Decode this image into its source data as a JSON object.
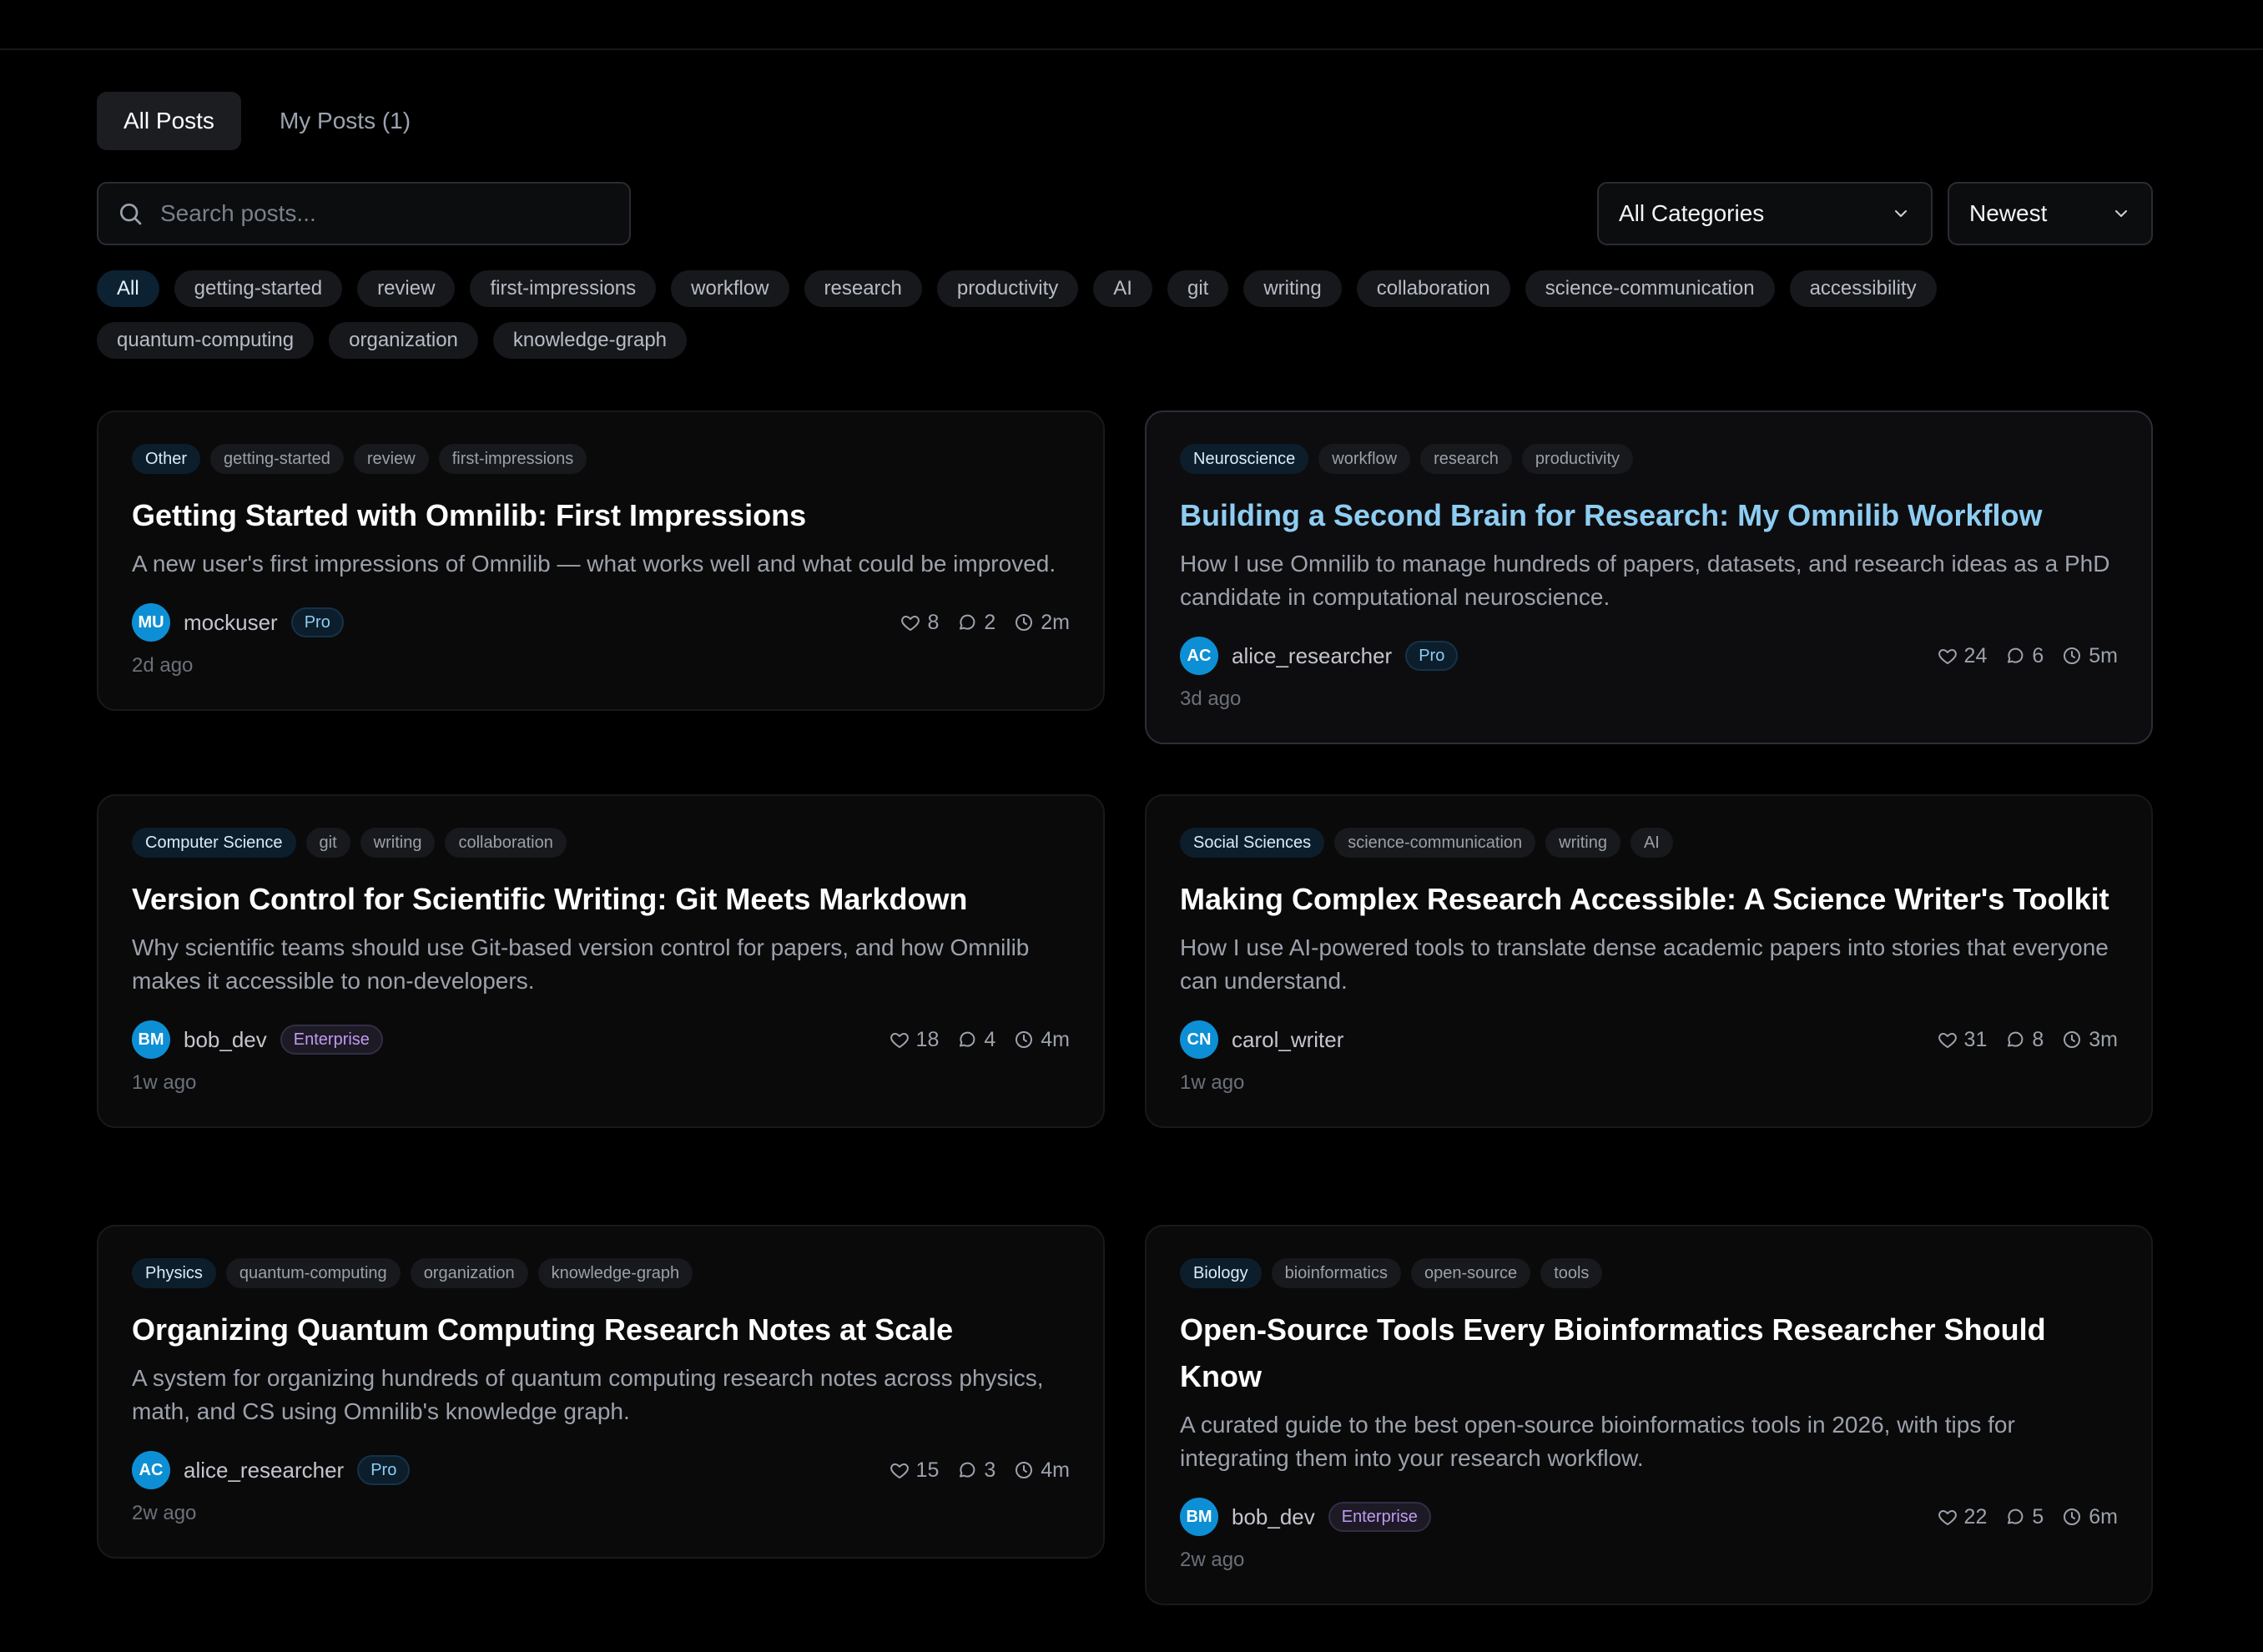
{
  "tabs": [
    {
      "label": "All Posts",
      "active": true
    },
    {
      "label": "My Posts (1)",
      "active": false
    }
  ],
  "search": {
    "placeholder": "Search posts...",
    "value": ""
  },
  "filters": {
    "category": "All Categories",
    "sort": "Newest"
  },
  "tag_chips": [
    "All",
    "getting-started",
    "review",
    "first-impressions",
    "workflow",
    "research",
    "productivity",
    "AI",
    "git",
    "writing",
    "collaboration",
    "science-communication",
    "accessibility",
    "quantum-computing",
    "organization",
    "knowledge-graph"
  ],
  "posts": [
    {
      "category": "Other",
      "tags": [
        "getting-started",
        "review",
        "first-impressions"
      ],
      "title": "Getting Started with Omnilib: First Impressions",
      "description": "A new user's first impressions of Omnilib — what works well and what could be improved.",
      "author_initials": "MU",
      "author": "mockuser",
      "badge": "Pro",
      "likes": "8",
      "comments": "2",
      "read_time": "2m",
      "posted": "2d ago"
    },
    {
      "category": "Neuroscience",
      "tags": [
        "workflow",
        "research",
        "productivity"
      ],
      "title": "Building a Second Brain for Research: My Omnilib Workflow",
      "description": "How I use Omnilib to manage hundreds of papers, datasets, and research ideas as a PhD candidate in computational neuroscience.",
      "author_initials": "AC",
      "author": "alice_researcher",
      "badge": "Pro",
      "likes": "24",
      "comments": "6",
      "read_time": "5m",
      "posted": "3d ago"
    },
    {
      "category": "Computer Science",
      "tags": [
        "git",
        "writing",
        "collaboration"
      ],
      "title": "Version Control for Scientific Writing: Git Meets Markdown",
      "description": "Why scientific teams should use Git-based version control for papers, and how Omnilib makes it accessible to non-developers.",
      "author_initials": "BM",
      "author": "bob_dev",
      "badge": "Enterprise",
      "likes": "18",
      "comments": "4",
      "read_time": "4m",
      "posted": "1w ago"
    },
    {
      "category": "Social Sciences",
      "tags": [
        "science-communication",
        "writing",
        "AI"
      ],
      "title": "Making Complex Research Accessible: A Science Writer's Toolkit",
      "description": "How I use AI-powered tools to translate dense academic papers into stories that everyone can understand.",
      "author_initials": "CN",
      "author": "carol_writer",
      "badge": "",
      "likes": "31",
      "comments": "8",
      "read_time": "3m",
      "posted": "1w ago"
    },
    {
      "category": "Physics",
      "tags": [
        "quantum-computing",
        "organization",
        "knowledge-graph"
      ],
      "title": "Organizing Quantum Computing Research Notes at Scale",
      "description": "A system for organizing hundreds of quantum computing research notes across physics, math, and CS using Omnilib's knowledge graph.",
      "author_initials": "AC",
      "author": "alice_researcher",
      "badge": "Pro",
      "likes": "15",
      "comments": "3",
      "read_time": "4m",
      "posted": "2w ago"
    },
    {
      "category": "Biology",
      "tags": [
        "bioinformatics",
        "open-source",
        "tools"
      ],
      "title": "Open-Source Tools Every Bioinformatics Researcher Should Know",
      "description": "A curated guide to the best open-source bioinformatics tools in 2026, with tips for integrating them into your research workflow.",
      "author_initials": "BM",
      "author": "bob_dev",
      "badge": "Enterprise",
      "likes": "22",
      "comments": "5",
      "read_time": "6m",
      "posted": "2w ago"
    }
  ]
}
